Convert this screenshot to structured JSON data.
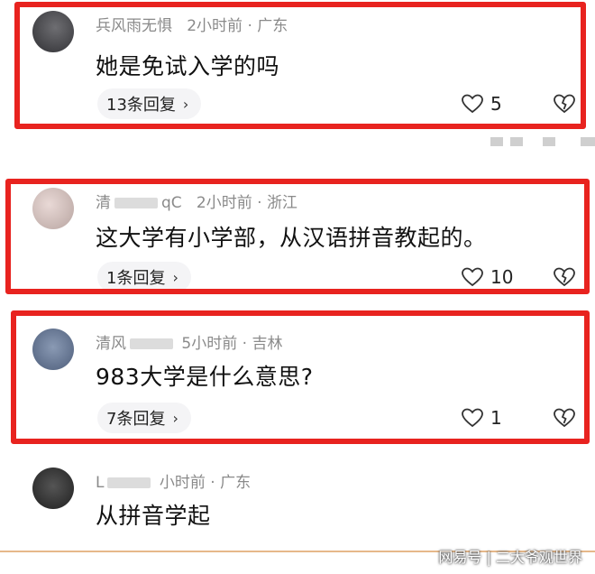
{
  "comments": [
    {
      "username": "兵风雨无惧",
      "time": "2小时前",
      "location": "广东",
      "text": "她是免试入学的吗",
      "reply_label": "13条回复",
      "likes": "5"
    },
    {
      "username": "清",
      "username_tail": "qC",
      "time": "2小时前",
      "location": "浙江",
      "text": "这大学有小学部，从汉语拼音教起的。",
      "reply_label": "1条回复",
      "likes": "10"
    },
    {
      "username": "清风",
      "time": "5小时前",
      "location": "吉林",
      "text": "983大学是什么意思?",
      "reply_label": "7条回复",
      "likes": "1"
    },
    {
      "username": "L",
      "time": "小时前",
      "location": "广东",
      "text": "从拼音学起"
    }
  ],
  "watermark": "网易号 | 二大爷观世界",
  "colors": {
    "highlight": "#e8231f",
    "meta": "#8a8a8a"
  }
}
